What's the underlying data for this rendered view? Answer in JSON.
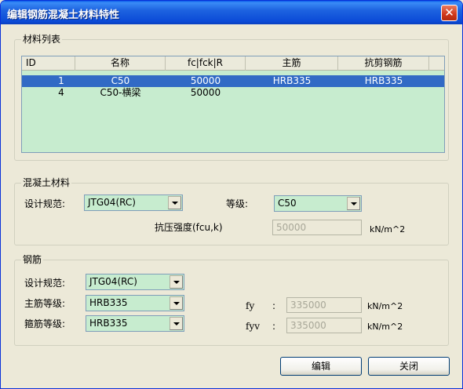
{
  "window": {
    "title": "编辑钢筋混凝土材料特性"
  },
  "materials_group": {
    "label": "材料列表"
  },
  "material_list": {
    "columns": [
      "ID",
      "名称",
      "fc|fck|R",
      "主筋",
      "抗剪钢筋"
    ],
    "rows": [
      {
        "id": "1",
        "name": "C50",
        "fc": "50000",
        "main_rebar": "HRB335",
        "shear_rebar": "HRB335",
        "selected": true
      },
      {
        "id": "4",
        "name": "C50-横梁",
        "fc": "50000",
        "main_rebar": "",
        "shear_rebar": "",
        "selected": false
      }
    ]
  },
  "concrete_group": {
    "label": "混凝土材料",
    "code_label": "设计规范:",
    "code_value": "JTG04(RC)",
    "grade_label": "等级:",
    "grade_value": "C50",
    "strength_label": "抗压强度(fcu,k)",
    "strength_value": "50000",
    "strength_unit": "kN/m^2"
  },
  "rebar_group": {
    "label": "钢筋",
    "code_label": "设计规范:",
    "code_value": "JTG04(RC)",
    "main_label": "主筋等级:",
    "main_value": "HRB335",
    "stirrup_label": "箍筋等级:",
    "stirrup_value": "HRB335",
    "fy_label": "fy",
    "fy_colon": ":",
    "fy_value": "335000",
    "fy_unit": "kN/m^2",
    "fyv_label": "fyv",
    "fyv_colon": ":",
    "fyv_value": "335000",
    "fyv_unit": "kN/m^2"
  },
  "buttons": {
    "edit": "编辑",
    "close": "关闭"
  }
}
